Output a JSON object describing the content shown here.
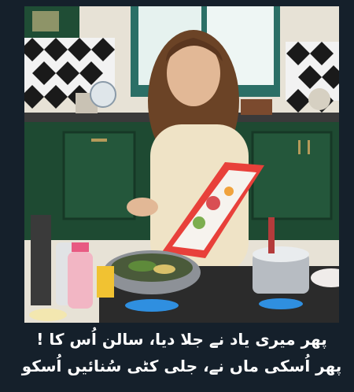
{
  "caption": {
    "line1": "پھر میری یاد نے جلا دیا، سالن اُس کا !",
    "line2": "پھر اُسکی ماں نے، جلی کٹی سُنائیں اُسکو"
  },
  "photo": {
    "subject": "cooking-woman-image"
  },
  "colors": {
    "background": "#15202b",
    "caption_text": "#ffffff",
    "cabinet_green": "#1e4a32",
    "board_red": "#e8403a"
  }
}
